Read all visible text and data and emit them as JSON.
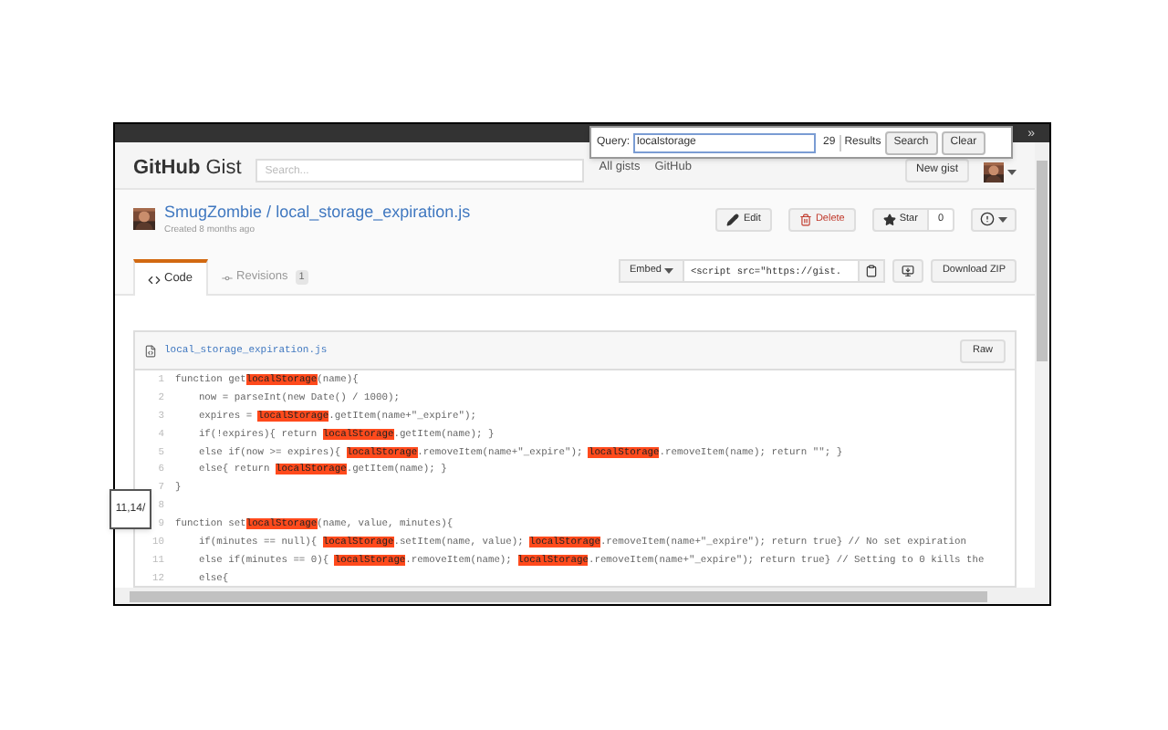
{
  "window": {
    "toolbar_glyph": "»"
  },
  "find_bar": {
    "label": "Query:",
    "value": "localstorage",
    "count": "29",
    "results_label": "Results",
    "buttons": [
      "Search",
      "Clear"
    ]
  },
  "header": {
    "logo_bold": "GitHub",
    "logo_light": "Gist",
    "search_placeholder": "Search...",
    "links": [
      "All gists",
      "GitHub"
    ],
    "new_button": "New gist"
  },
  "gist": {
    "owner": "SmugZombie",
    "separator": "/",
    "name": "local_storage_expiration.js",
    "created": "Created 8 months ago",
    "actions": [
      {
        "kind": "edit",
        "label": "Edit"
      },
      {
        "kind": "delete",
        "label": "Delete"
      },
      {
        "kind": "star",
        "label": "Star",
        "count": "0"
      },
      {
        "kind": "alert"
      }
    ]
  },
  "tabs": [
    {
      "label": "Code",
      "selected": true
    },
    {
      "label": "Revisions",
      "count": "1",
      "selected": false
    }
  ],
  "embed": {
    "label": "Embed",
    "value": "<script src=\"https://gist."
  },
  "download": "Download ZIP",
  "file": {
    "name": "local_storage_expiration.js",
    "raw": "Raw",
    "lines": [
      {
        "number": "1",
        "segments": [
          {
            "text": "function get",
            "highlight": false
          },
          {
            "text": "localStorage",
            "highlight": true
          },
          {
            "text": "(name){",
            "highlight": false
          }
        ]
      },
      {
        "number": "2",
        "segments": [
          {
            "text": "    now = parseInt(new Date() / 1000);",
            "highlight": false
          }
        ]
      },
      {
        "number": "3",
        "segments": [
          {
            "text": "    expires = ",
            "highlight": false
          },
          {
            "text": "localStorage",
            "highlight": true
          },
          {
            "text": ".getItem(name+\"_expire\");",
            "highlight": false
          }
        ]
      },
      {
        "number": "4",
        "segments": [
          {
            "text": "    if(!expires){ return ",
            "highlight": false
          },
          {
            "text": "localStorage",
            "highlight": true
          },
          {
            "text": ".getItem(name); }",
            "highlight": false
          }
        ]
      },
      {
        "number": "5",
        "segments": [
          {
            "text": "    else if(now >= expires){ ",
            "highlight": false
          },
          {
            "text": "localStorage",
            "highlight": true
          },
          {
            "text": ".removeItem(name+\"_expire\"); ",
            "highlight": false
          },
          {
            "text": "localStorage",
            "highlight": true
          },
          {
            "text": ".removeItem(name); return \"\"; }",
            "highlight": false
          }
        ]
      },
      {
        "number": "6",
        "segments": [
          {
            "text": "    else{ return ",
            "highlight": false
          },
          {
            "text": "localStorage",
            "highlight": true
          },
          {
            "text": ".getItem(name); }",
            "highlight": false
          }
        ]
      },
      {
        "number": "7",
        "segments": [
          {
            "text": "}",
            "highlight": false
          }
        ]
      },
      {
        "number": "8"
      },
      {
        "number": "9",
        "segments": [
          {
            "text": "function set",
            "highlight": false
          },
          {
            "text": "localStorage",
            "highlight": true
          },
          {
            "text": "(name, value, minutes){",
            "highlight": false
          }
        ]
      },
      {
        "number": "10",
        "segments": [
          {
            "text": "    if(minutes == null){ ",
            "highlight": false
          },
          {
            "text": "localStorage",
            "highlight": true
          },
          {
            "text": ".setItem(name, value); ",
            "highlight": false
          },
          {
            "text": "localStorage",
            "highlight": true
          },
          {
            "text": ".removeItem(name+\"_expire\"); return true} // No set expiration",
            "highlight": false
          }
        ]
      },
      {
        "number": "11",
        "segments": [
          {
            "text": "    else if(minutes == 0){ ",
            "highlight": false
          },
          {
            "text": "localStorage",
            "highlight": true
          },
          {
            "text": ".removeItem(name); ",
            "highlight": false
          },
          {
            "text": "localStorage",
            "highlight": true
          },
          {
            "text": ".removeItem(name+\"_expire\"); return true} // Setting to 0 kills the",
            "highlight": false
          }
        ]
      },
      {
        "number": "12",
        "segments": [
          {
            "text": "    else{",
            "highlight": false
          }
        ]
      }
    ]
  },
  "tooltip": "11,14/"
}
